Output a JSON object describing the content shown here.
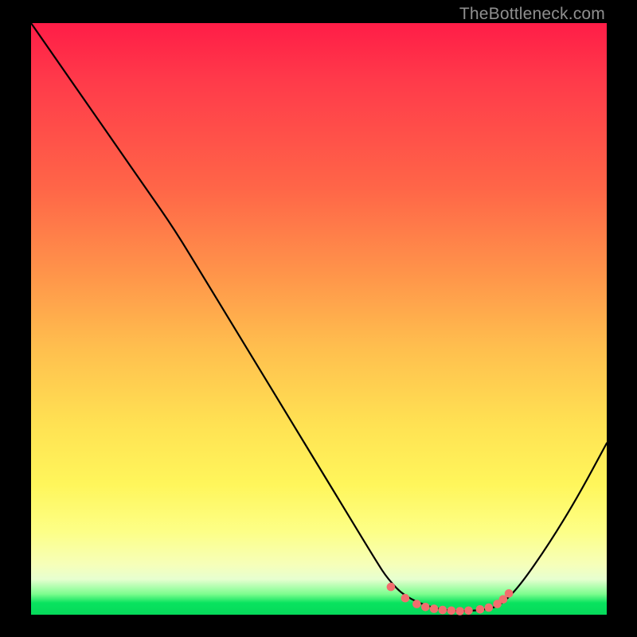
{
  "watermark": "TheBottleneck.com",
  "chart_data": {
    "type": "line",
    "title": "",
    "xlabel": "",
    "ylabel": "",
    "xlim": [
      0,
      100
    ],
    "ylim": [
      0,
      100
    ],
    "grid": false,
    "annotations": [],
    "series": [
      {
        "name": "black-curve",
        "color": "#000000",
        "x": [
          0,
          5,
          10,
          15,
          20,
          25,
          30,
          35,
          40,
          45,
          50,
          55,
          60,
          62,
          65,
          70,
          75,
          80,
          82,
          85,
          90,
          95,
          100
        ],
        "y": [
          100,
          93,
          86,
          79,
          72,
          65,
          57,
          49,
          41,
          33,
          25,
          17,
          9,
          6,
          3,
          1,
          0.5,
          1,
          2,
          5,
          12,
          20,
          29
        ]
      },
      {
        "name": "pink-dots",
        "color": "#f26e6e",
        "x": [
          62.5,
          65.0,
          67.0,
          68.5,
          70.0,
          71.5,
          73.0,
          74.5,
          76.0,
          78.0,
          79.5,
          81.0,
          82.0,
          83.0
        ],
        "y": [
          4.7,
          2.8,
          1.8,
          1.3,
          1.0,
          0.8,
          0.7,
          0.6,
          0.7,
          0.9,
          1.2,
          1.8,
          2.6,
          3.6
        ]
      }
    ],
    "background_gradient": {
      "top": "#ff1d47",
      "upper_mid": "#ff934a",
      "mid": "#ffe253",
      "lower_mid": "#fdff87",
      "near_bottom": "#7dfd8f",
      "bottom": "#06d95a"
    }
  }
}
